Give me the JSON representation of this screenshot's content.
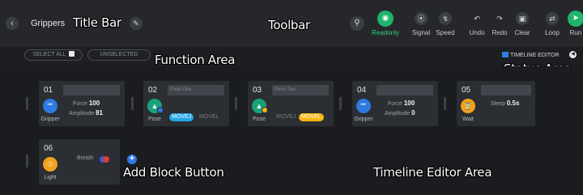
{
  "header": {
    "back_icon": "chevron-left-icon",
    "title": "Grippers",
    "edit_icon": "pencil-icon"
  },
  "annotations": {
    "title_bar": "Title Bar",
    "toolbar": "Toolbar",
    "function_area": "Function Area",
    "status_area": "Status Area",
    "add_block_button": "Add Block Button",
    "timeline_editor_area": "Timeline Editor Area"
  },
  "toolbar": {
    "search_icon": "search-icon",
    "readonly": "Readonly",
    "signal": "Signal",
    "speed": "Speed",
    "undo": "Undo",
    "redo": "Redo",
    "clear": "Clear",
    "loop": "Loop",
    "run": "Run"
  },
  "function_area": {
    "select_all": "SELECT ALL",
    "unselected": "UNSELECTED"
  },
  "status": {
    "timeline_editor": "TIMELINE EDITOR"
  },
  "blocks": [
    {
      "num": "01",
      "type": "Gripper",
      "icon": "gripper-icon",
      "name": "",
      "force_label": "Force",
      "force": "100",
      "amp_label": "Amplitude",
      "amp": "81"
    },
    {
      "num": "02",
      "type": "Pose",
      "icon": "navigation-arrow-icon",
      "name": "Pose One",
      "movej": "MOVEJ",
      "movel": "MOVEL",
      "active": "MOVEJ"
    },
    {
      "num": "03",
      "type": "Pose",
      "icon": "navigation-arrow-icon",
      "name": "Pose Two",
      "movej": "MOVEJ",
      "movel": "MOVEL",
      "active": "MOVEL"
    },
    {
      "num": "04",
      "type": "Gripper",
      "icon": "gripper-icon",
      "name": "",
      "force_label": "Force",
      "force": "100",
      "amp_label": "Amplitude",
      "amp": "0"
    },
    {
      "num": "05",
      "type": "Wait",
      "icon": "hourglass-icon",
      "name": "",
      "sleep_label": "Sleep",
      "sleep": "0.5s"
    },
    {
      "num": "06",
      "type": "Light",
      "icon": "light-icon",
      "name": "",
      "breath_label": "Breath"
    }
  ],
  "colors": {
    "accent_green": "#1fb36b",
    "blue": "#2d7ae0",
    "teal": "#1aa27a",
    "orange": "#f0a21c",
    "movej_active": "#22a6e6",
    "movel_active": "#f4b512"
  }
}
